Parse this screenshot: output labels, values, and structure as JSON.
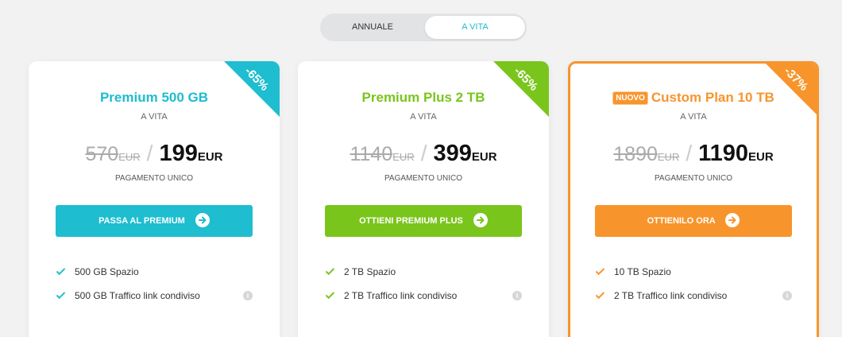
{
  "billing_toggle": {
    "annual": "ANNUALE",
    "lifetime": "A VITA",
    "selected": "lifetime"
  },
  "colors": {
    "teal": "#1ebdcf",
    "green": "#7ac51c",
    "orange": "#f7952c"
  },
  "plans": [
    {
      "title": "Premium 500 GB",
      "subtitle": "A VITA",
      "discount": "-65%",
      "old_price": "570",
      "old_currency": "EUR",
      "new_price": "199",
      "new_currency": "EUR",
      "payment_note": "PAGAMENTO UNICO",
      "cta": "PASSA AL PREMIUM",
      "features": [
        "500 GB Spazio",
        "500 GB Traffico link condiviso"
      ]
    },
    {
      "title": "Premium Plus 2 TB",
      "subtitle": "A VITA",
      "discount": "-65%",
      "old_price": "1140",
      "old_currency": "EUR",
      "new_price": "399",
      "new_currency": "EUR",
      "payment_note": "PAGAMENTO UNICO",
      "cta": "OTTIENI PREMIUM PLUS",
      "features": [
        "2 TB Spazio",
        "2 TB Traffico link condiviso"
      ]
    },
    {
      "badge": "NUOVO",
      "title": "Custom Plan 10 TB",
      "subtitle": "A VITA",
      "discount": "-37%",
      "old_price": "1890",
      "old_currency": "EUR",
      "new_price": "1190",
      "new_currency": "EUR",
      "payment_note": "PAGAMENTO UNICO",
      "cta": "OTTIENILO ORA",
      "features": [
        "10 TB Spazio",
        "2 TB Traffico link condiviso"
      ]
    }
  ]
}
